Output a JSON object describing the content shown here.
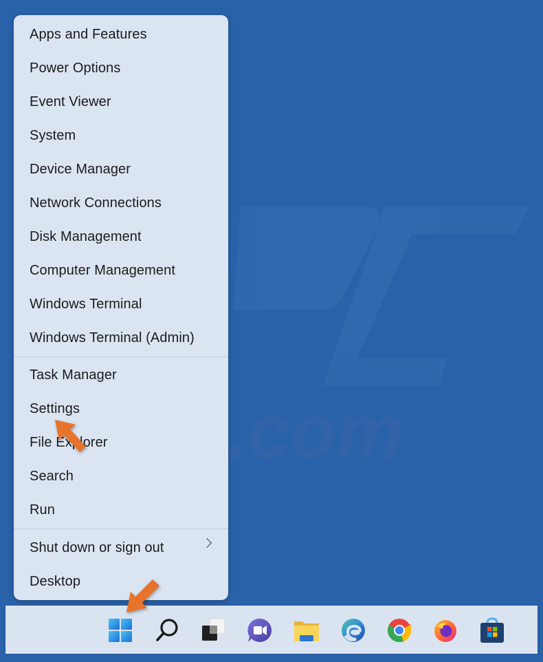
{
  "menu": {
    "groups": [
      {
        "items": [
          {
            "label": "Apps and Features"
          },
          {
            "label": "Power Options"
          },
          {
            "label": "Event Viewer"
          },
          {
            "label": "System"
          },
          {
            "label": "Device Manager"
          },
          {
            "label": "Network Connections"
          },
          {
            "label": "Disk Management"
          },
          {
            "label": "Computer Management"
          },
          {
            "label": "Windows Terminal"
          },
          {
            "label": "Windows Terminal (Admin)"
          }
        ]
      },
      {
        "items": [
          {
            "label": "Task Manager"
          },
          {
            "label": "Settings"
          },
          {
            "label": "File Explorer"
          },
          {
            "label": "Search"
          },
          {
            "label": "Run"
          }
        ]
      },
      {
        "items": [
          {
            "label": "Shut down or sign out",
            "submenu": true
          },
          {
            "label": "Desktop"
          }
        ]
      }
    ]
  },
  "taskbar": {
    "icons": [
      "start-icon",
      "search-icon",
      "task-view-icon",
      "teams-chat-icon",
      "file-explorer-icon",
      "edge-icon",
      "chrome-icon",
      "firefox-icon",
      "microsoft-store-icon"
    ]
  },
  "colors": {
    "desktop": "#2a62aa",
    "menu_bg": "#dbe5f1",
    "taskbar_bg": "#dae4f0",
    "annotation_arrow": "#e8732a"
  }
}
